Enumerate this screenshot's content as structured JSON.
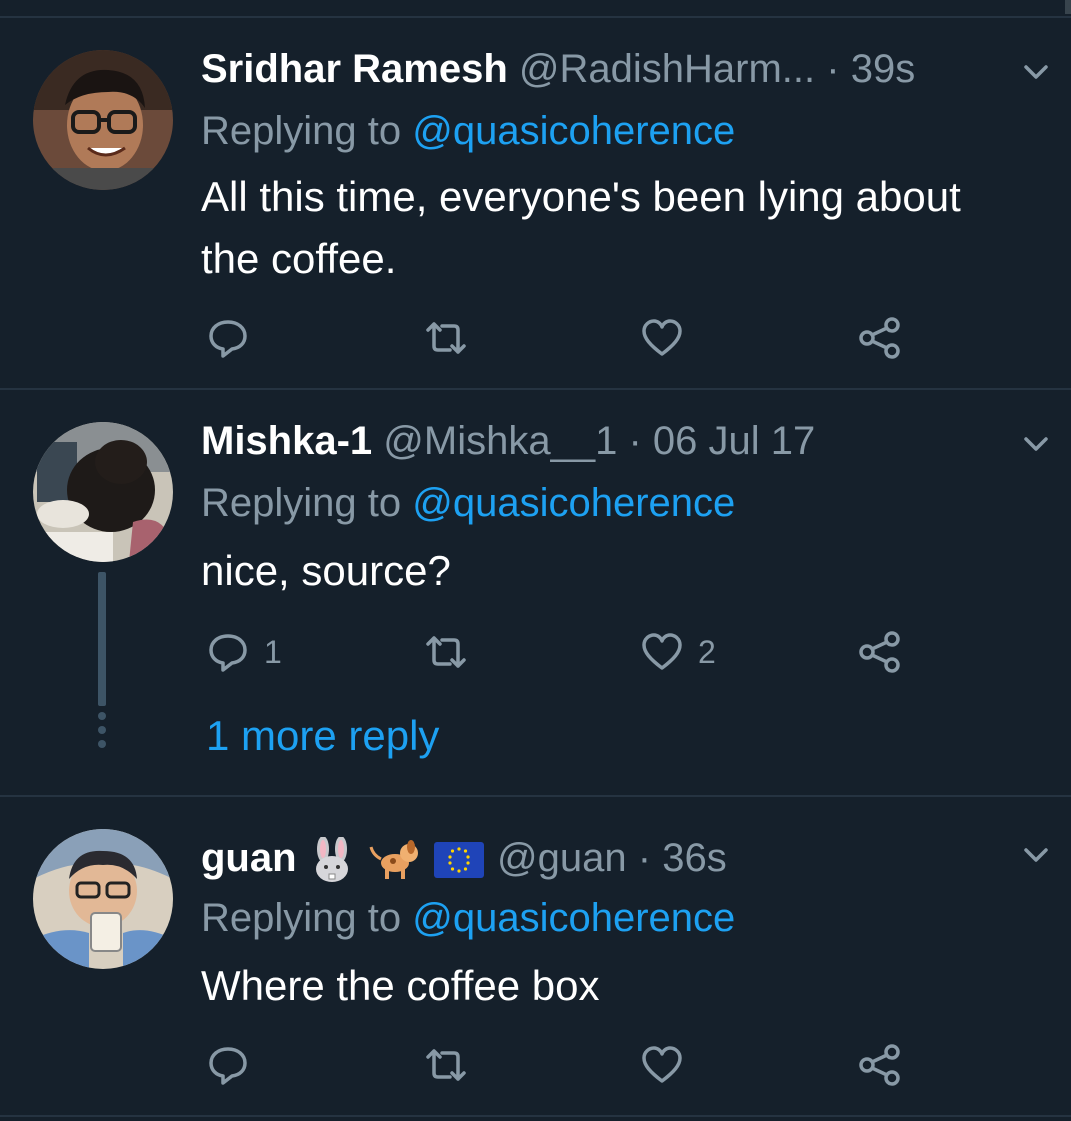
{
  "tweets": [
    {
      "name": "Sridhar Ramesh",
      "handle": "@RadishHarm...",
      "dot": "·",
      "time": "39s",
      "replying_prefix": "Replying to",
      "replying_to": "@quasicoherence",
      "text_line1": "All this time, everyone's been lying about",
      "text_line2": "the coffee.",
      "reply_count": "",
      "retweet_count": "",
      "like_count": ""
    },
    {
      "name": "Mishka-1",
      "handle": "@Mishka__1",
      "dot": "·",
      "time": "06 Jul 17",
      "replying_prefix": "Replying to",
      "replying_to": "@quasicoherence",
      "text_line1": "nice, source?",
      "reply_count": "1",
      "retweet_count": "",
      "like_count": "2",
      "more_replies": "1 more reply"
    },
    {
      "name": "guan",
      "name_emojis": [
        "rabbit-face-icon",
        "dog-icon",
        "eu-flag-icon"
      ],
      "handle": "@guan",
      "dot": "·",
      "time": "36s",
      "replying_prefix": "Replying to",
      "replying_to": "@quasicoherence",
      "text_line1": "Where the coffee box",
      "reply_count": "",
      "retweet_count": "",
      "like_count": ""
    }
  ],
  "colors": {
    "background": "#15202b",
    "separator": "#253341",
    "secondary_text": "#8899a6",
    "link": "#1da1f2"
  }
}
